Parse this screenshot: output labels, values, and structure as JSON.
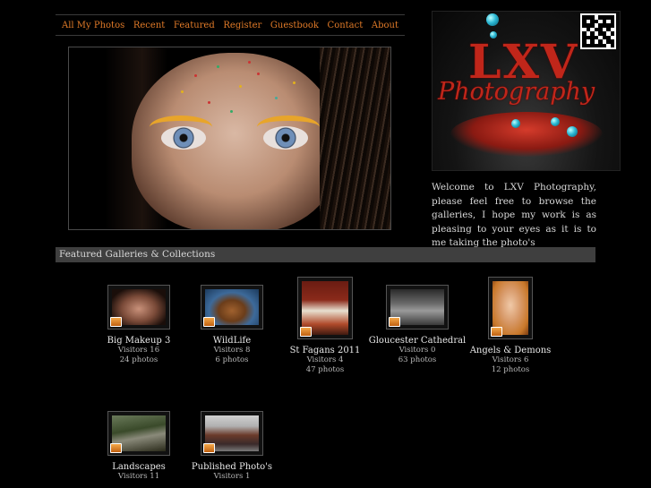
{
  "nav": {
    "items": [
      {
        "label": "All My Photos"
      },
      {
        "label": "Recent"
      },
      {
        "label": "Featured"
      },
      {
        "label": "Register"
      },
      {
        "label": "Guestbook"
      },
      {
        "label": "Contact"
      },
      {
        "label": "About"
      }
    ],
    "link_color": "#e07a28"
  },
  "logo": {
    "line1": "LXV",
    "line2": "Photography",
    "brand_color": "#c0261a"
  },
  "welcome": {
    "text": "Welcome to LXV Photography, please feel free to browse the galleries, I hope my work is as pleasing to your eyes as it is to me taking the photo's"
  },
  "featured": {
    "heading": "Featured Galleries & Collections",
    "galleries": [
      {
        "name": "Big Makeup 3",
        "visitors": "Visitors 16",
        "photos": "24 photos",
        "icon": "makeup-face-thumbnail"
      },
      {
        "name": "WildLife",
        "visitors": "Visitors 8",
        "photos": "6 photos",
        "icon": "dog-thumbnail"
      },
      {
        "name": "St Fagans 2011",
        "visitors": "Visitors 4",
        "photos": "47 photos",
        "icon": "table-scene-thumbnail"
      },
      {
        "name": "Gloucester Cathedral",
        "visitors": "Visitors 0",
        "photos": "63 photos",
        "icon": "cathedral-thumbnail"
      },
      {
        "name": "Angels & Demons",
        "visitors": "Visitors 6",
        "photos": "12 photos",
        "icon": "portrait-thumbnail"
      },
      {
        "name": "Landscapes",
        "visitors": "Visitors 11",
        "photos": "",
        "icon": "landscape-thumbnail"
      },
      {
        "name": "Published Photo's",
        "visitors": "Visitors 1",
        "photos": "",
        "icon": "shop-front-thumbnail"
      }
    ]
  }
}
